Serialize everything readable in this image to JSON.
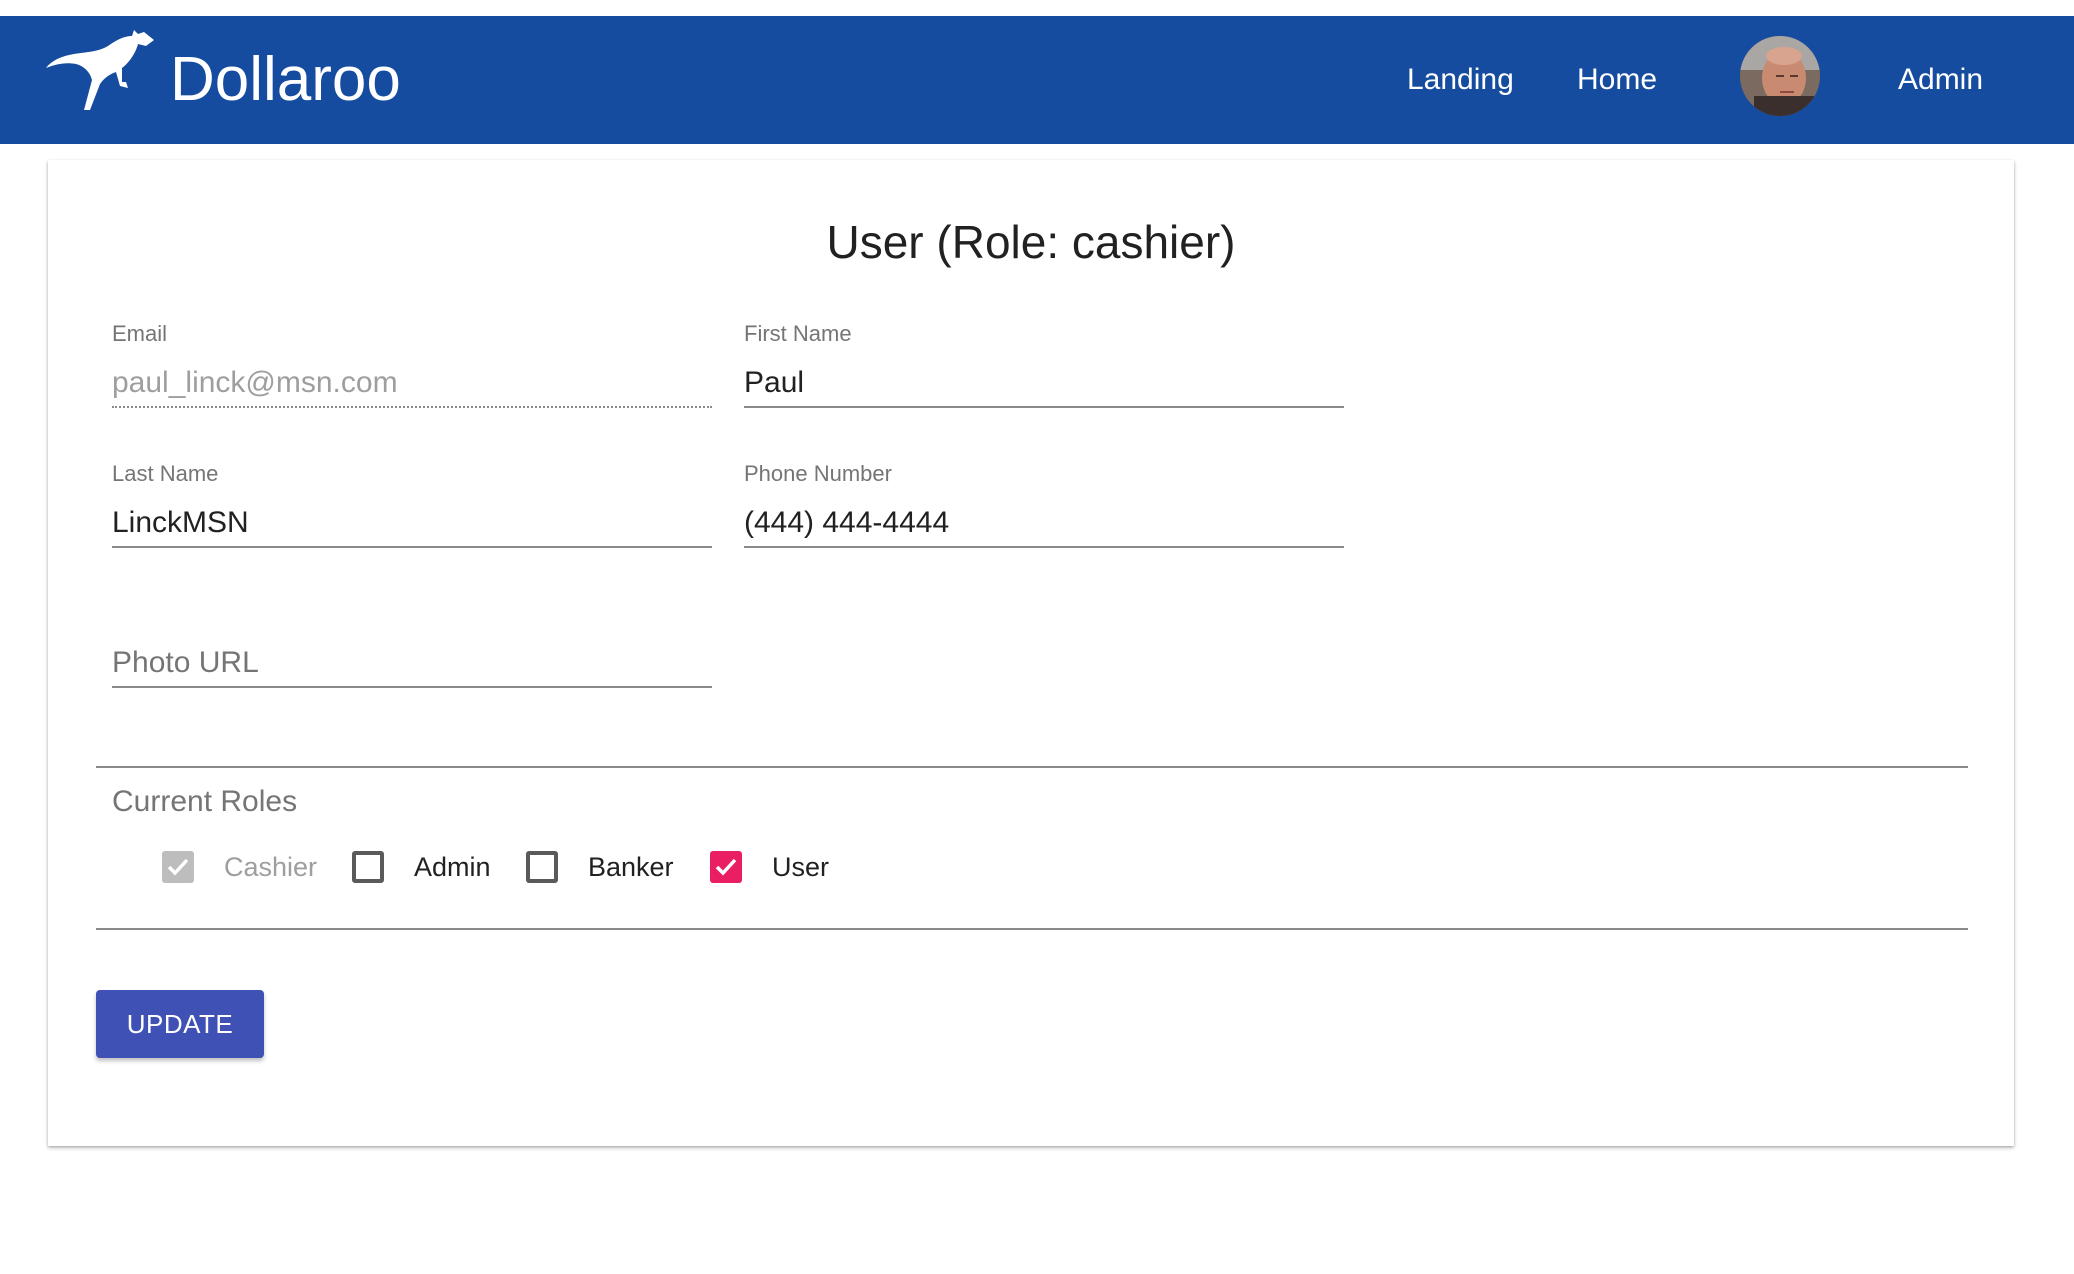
{
  "appbar": {
    "brand": "Dollaroo",
    "nav": {
      "landing": "Landing",
      "home": "Home",
      "admin": "Admin"
    },
    "bar_color": "#154c9f"
  },
  "form": {
    "title": "User (Role: cashier)",
    "email": {
      "label": "Email",
      "value": "paul_linck@msn.com"
    },
    "first_name": {
      "label": "First Name",
      "value": "Paul"
    },
    "last_name": {
      "label": "Last Name",
      "value": "LinckMSN"
    },
    "phone": {
      "label": "Phone Number",
      "value": "(444) 444-4444"
    },
    "photo_url": {
      "placeholder": "Photo URL",
      "value": ""
    }
  },
  "roles": {
    "title": "Current Roles",
    "items": [
      {
        "label": "Cashier",
        "checked": true,
        "disabled": true
      },
      {
        "label": "Admin",
        "checked": false,
        "disabled": false
      },
      {
        "label": "Banker",
        "checked": false,
        "disabled": false
      },
      {
        "label": "User",
        "checked": true,
        "disabled": false
      }
    ],
    "check_color": "#e91e63"
  },
  "actions": {
    "update_label": "UPDATE",
    "button_color": "#3f51b5"
  }
}
